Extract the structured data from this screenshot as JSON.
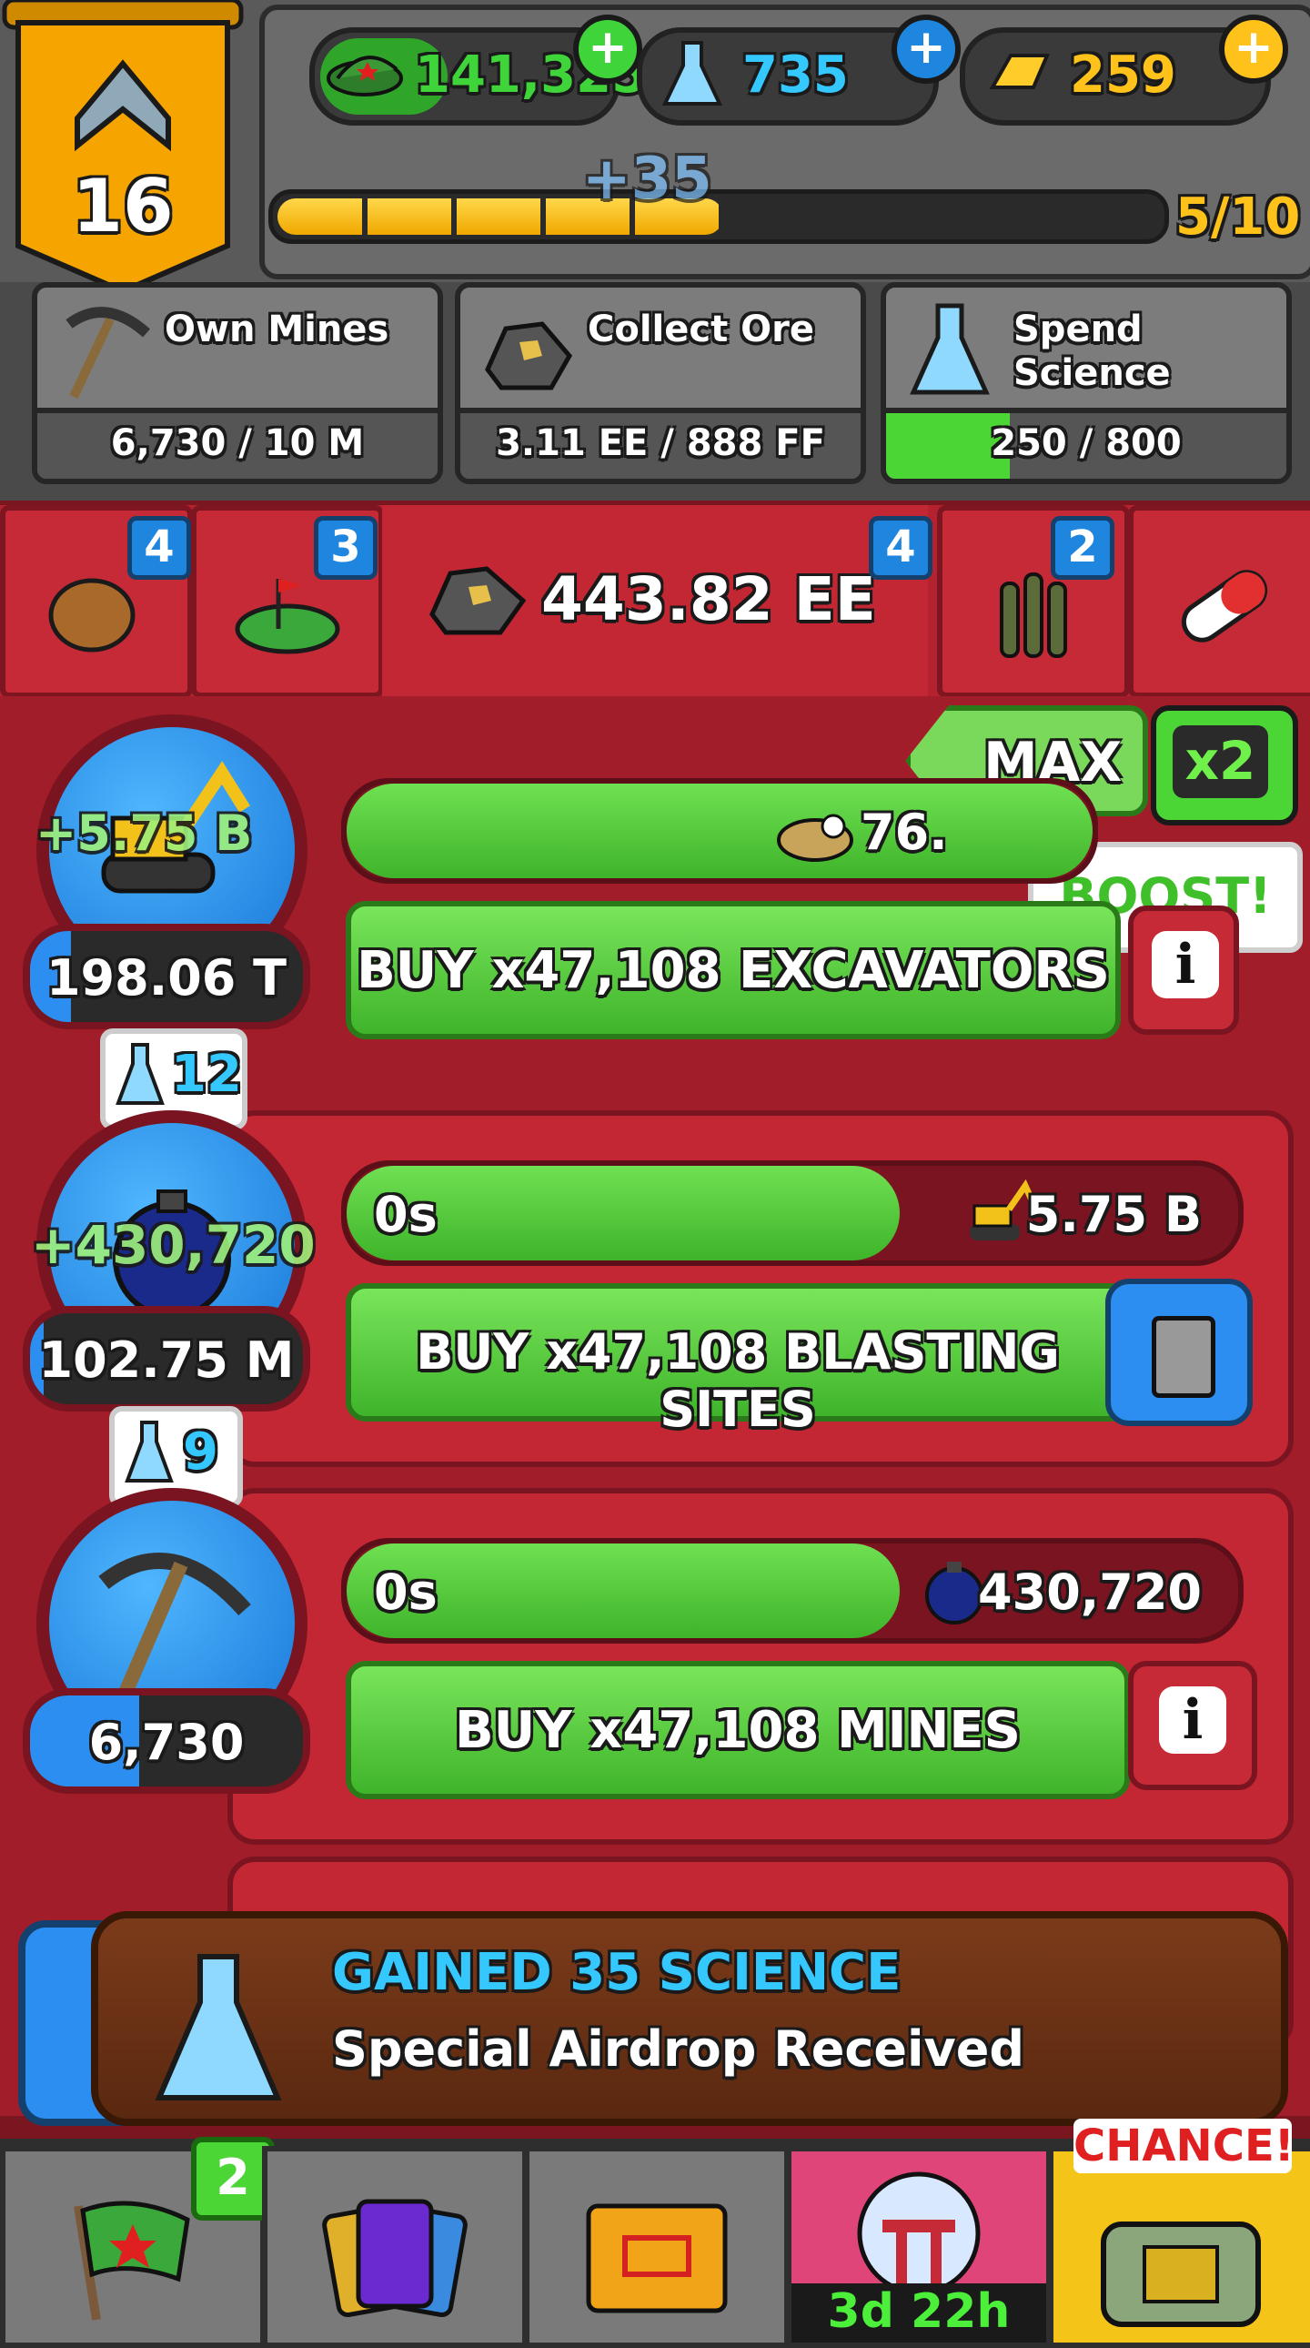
{
  "player": {
    "level": "16"
  },
  "currencies": {
    "cash": "141,325",
    "science": "735",
    "gold": "259"
  },
  "xp": {
    "popup": "+35",
    "progress_label": "5/10",
    "progress": 0.5
  },
  "goals": [
    {
      "label": "Own Mines",
      "value": "6,730 / 10 M",
      "progress": 0.0
    },
    {
      "label": "Collect Ore",
      "value": "3.11 EE / 888 FF",
      "progress": 0.0
    },
    {
      "label": "Spend Science",
      "value": "250 / 800",
      "progress": 0.31
    }
  ],
  "tabs": {
    "potato_badge": "4",
    "land_badge": "3",
    "ore_total": "443.82 EE",
    "right_badge": "4",
    "ammo_badge": "2"
  },
  "controls": {
    "max_label": "MAX",
    "boost_multiplier": "x2",
    "boost_label": "BOOST!"
  },
  "rows": [
    {
      "name": "excavators",
      "gain": "+5.75 B",
      "count": "198.06 T",
      "count_fill": 0.15,
      "prod_right": "76.",
      "buy_label": "BUY x47,108 EXCAVATORS"
    },
    {
      "name": "blasting-sites",
      "science_cost": "12",
      "gain": "+430,720",
      "count": "102.75 M",
      "count_fill": 0.05,
      "timer": "0s",
      "prod_right": "5.75 B",
      "buy_label": "BUY x47,108 BLASTING SITES"
    },
    {
      "name": "mines",
      "science_cost": "9",
      "count": "6,730",
      "count_fill": 0.4,
      "timer": "0s",
      "prod_right": "430,720",
      "buy_label": "BUY x47,108 MINES"
    }
  ],
  "toast": {
    "title": "GAINED 35 SCIENCE",
    "message": "Special Airdrop Received"
  },
  "bottom_nav": {
    "missions_badge": "2",
    "event_timer": "3d 22h",
    "chance_label": "CHANCE!"
  },
  "colors": {
    "cash_green": "#3fd43a",
    "science_blue": "#35c8ff",
    "gold_yellow": "#ffc21a",
    "panel_red": "#c32734"
  }
}
